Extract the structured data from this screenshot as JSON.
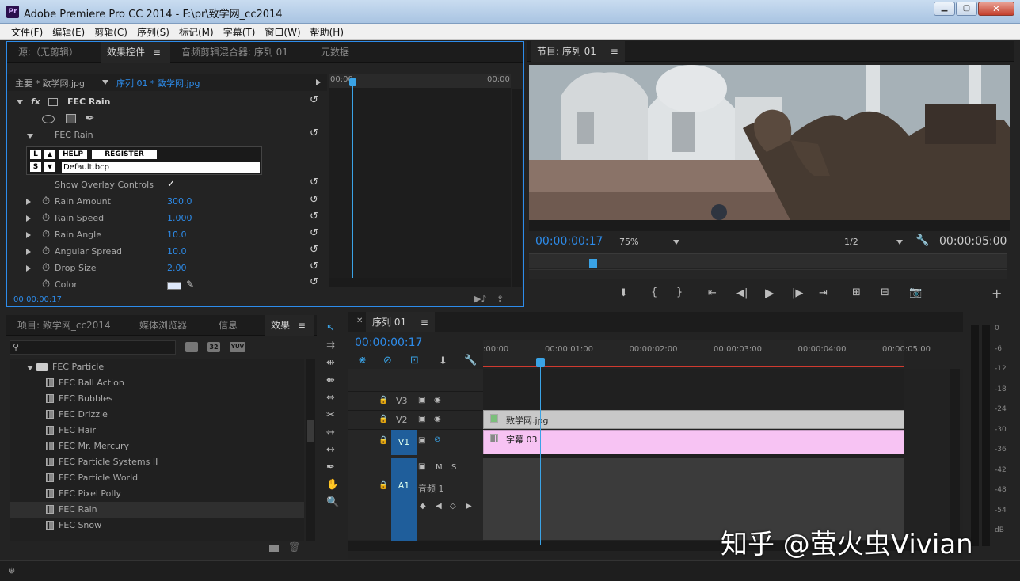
{
  "app": {
    "title": "Adobe Premiere Pro CC 2014 - F:\\pr\\致学网_cc2014",
    "logo": "Pr"
  },
  "menu": [
    "文件(F)",
    "编辑(E)",
    "剪辑(C)",
    "序列(S)",
    "标记(M)",
    "字幕(T)",
    "窗口(W)",
    "帮助(H)"
  ],
  "top_left": {
    "tabs": [
      "源:（无剪辑）",
      "效果控件",
      "音频剪辑混合器: 序列 01",
      "元数据"
    ],
    "master": "主要 * 致学网.jpg",
    "sequence": "序列 01 * 致学网.jpg",
    "tl_start": "00:00",
    "tl_end": "00:00",
    "effect_name": "FEC Rain",
    "sub_name": "FEC Rain",
    "plugin": {
      "l": "L",
      "s": "S",
      "help": "HELP",
      "register": "REGISTER",
      "preset": "Default.bcp"
    },
    "overlay_label": "Show Overlay Controls",
    "overlay_check": "✓",
    "props": [
      {
        "name": "Rain Amount",
        "value": "300.0"
      },
      {
        "name": "Rain Speed",
        "value": "1.000"
      },
      {
        "name": "Rain Angle",
        "value": "10.0"
      },
      {
        "name": "Angular Spread",
        "value": "10.0"
      },
      {
        "name": "Drop Size",
        "value": "2.00"
      }
    ],
    "color_label": "Color",
    "timecode": "00:00:00:17"
  },
  "program": {
    "tab": "节目: 序列 01",
    "timecode": "00:00:00:17",
    "zoom": "75%",
    "quality": "1/2",
    "duration": "00:00:05:00"
  },
  "project": {
    "tabs": [
      "项目: 致学网_cc2014",
      "媒体浏览器",
      "信息",
      "效果"
    ],
    "folder": "FEC Particle",
    "items": [
      "FEC Ball Action",
      "FEC Bubbles",
      "FEC Drizzle",
      "FEC Hair",
      "FEC Mr. Mercury",
      "FEC Particle Systems II",
      "FEC Particle World",
      "FEC Pixel Polly",
      "FEC Rain",
      "FEC Snow"
    ],
    "badges": [
      "32",
      "YUV"
    ]
  },
  "timeline": {
    "tab": "序列 01",
    "timecode": "00:00:00:17",
    "ruler": [
      ":00:00",
      "00:00:01:00",
      "00:00:02:00",
      "00:00:03:00",
      "00:00:04:00",
      "00:00:05:00"
    ],
    "tracks": {
      "v3": "V3",
      "v2": "V2",
      "v1": "V1",
      "a1": "A1",
      "m": "M",
      "s": "S",
      "audio_name": "音频 1"
    },
    "clip_v2": "致学网.jpg",
    "clip_v1": "字幕 03"
  },
  "meter": {
    "labels": [
      "0",
      "-6",
      "-12",
      "-18",
      "-24",
      "-30",
      "-36",
      "-42",
      "-48",
      "-54",
      "dB"
    ]
  },
  "watermark": "知乎 @萤火虫Vivian",
  "colors": {
    "accent": "#2d8ceb",
    "playhead": "#3aa3e6",
    "clip_v2": "#c8c8c8",
    "clip_v1": "#f7c3f3"
  }
}
